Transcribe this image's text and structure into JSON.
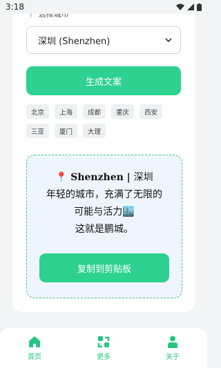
{
  "status_bar": {
    "time": "3:18"
  },
  "selector": {
    "label": "选择城市",
    "selected_value": "深圳 (Shenzhen)"
  },
  "buttons": {
    "generate": "生成文案",
    "copy": "复制到剪贴板"
  },
  "city_chips": [
    "北京",
    "上海",
    "成都",
    "重庆",
    "西安",
    "三亚",
    "厦门",
    "大理"
  ],
  "result": {
    "pin": "📍",
    "city_en": "Shenzhen",
    "separator": " | ",
    "city_cn": "深圳",
    "line1": "年轻的城市，充满了无限的",
    "line2": "可能与活力🏙️",
    "line3": "这就是鹏城。"
  },
  "bottom_nav": [
    {
      "label": "首页",
      "icon": "home-icon"
    },
    {
      "label": "更多",
      "icon": "more-icon"
    },
    {
      "label": "关于",
      "icon": "user-icon"
    }
  ],
  "colors": {
    "accent": "#2ed18f",
    "result_bg": "#eef5fe",
    "dashed_border": "#38c98a"
  }
}
